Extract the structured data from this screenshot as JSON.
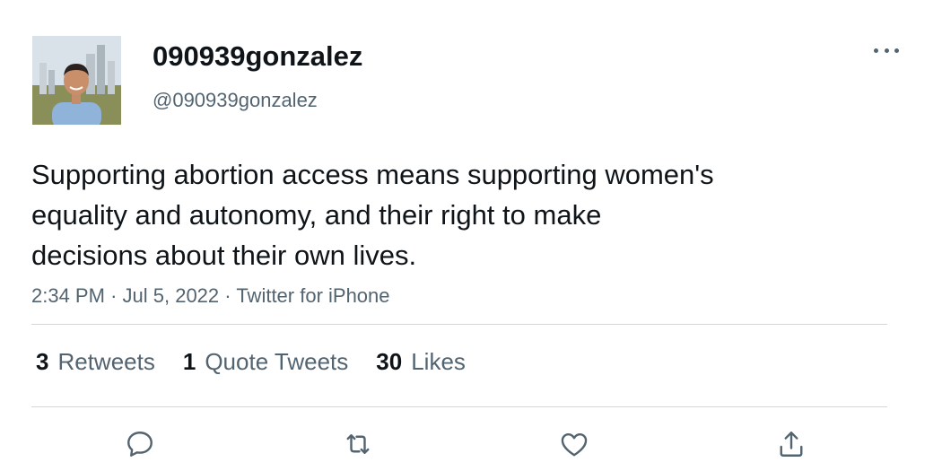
{
  "user": {
    "display_name": "090939gonzalez",
    "handle": "@090939gonzalez",
    "avatar_icon": "profile-photo"
  },
  "tweet": {
    "text": "Supporting abortion access means supporting women's\nequality and autonomy, and their right to make\ndecisions about their own lives.",
    "time": "2:34 PM",
    "date": "Jul 5, 2022",
    "source": "Twitter for iPhone",
    "separator": "·"
  },
  "stats": {
    "retweets": {
      "count": "3",
      "label": "Retweets"
    },
    "quote_tweets": {
      "count": "1",
      "label": "Quote Tweets"
    },
    "likes": {
      "count": "30",
      "label": "Likes"
    }
  },
  "actions": [
    "reply-icon",
    "retweet-icon",
    "like-icon",
    "share-icon"
  ],
  "colors": {
    "text": "#0f1419",
    "secondary": "#536471",
    "divider": "#cfd9de"
  }
}
